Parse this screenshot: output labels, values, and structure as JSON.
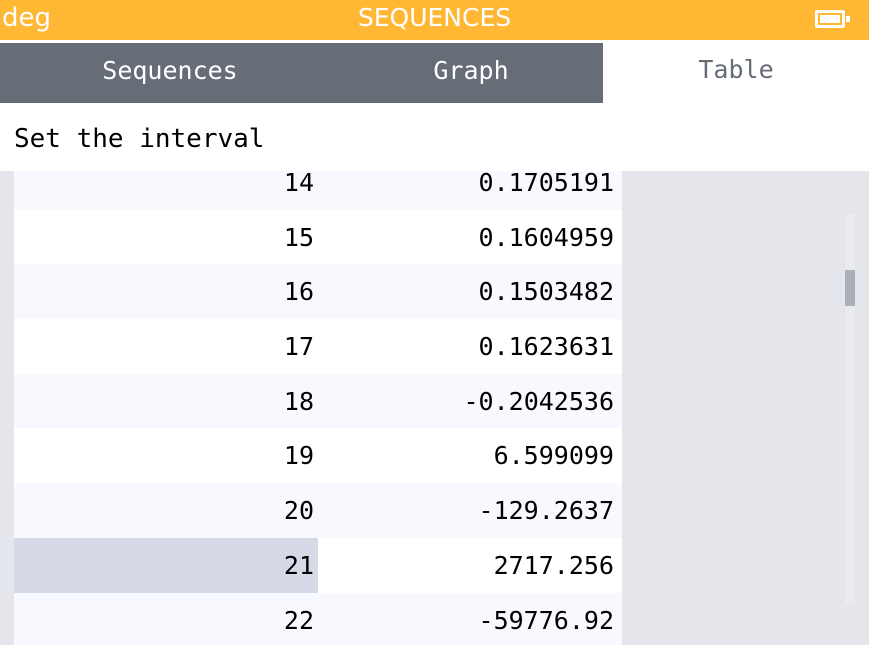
{
  "status_bar": {
    "mode": "deg",
    "title": "SEQUENCES",
    "battery_icon": "battery-icon",
    "color": "#ffb734"
  },
  "tabs": [
    {
      "label": "Sequences",
      "active": false
    },
    {
      "label": "Graph",
      "active": false
    },
    {
      "label": "Table",
      "active": true
    }
  ],
  "interval": {
    "label": "Set the interval"
  },
  "table": {
    "rows": [
      {
        "n": "14",
        "u": "0.1705191"
      },
      {
        "n": "15",
        "u": "0.1604959"
      },
      {
        "n": "16",
        "u": "0.1503482"
      },
      {
        "n": "17",
        "u": "0.1623631"
      },
      {
        "n": "18",
        "u": "-0.2042536"
      },
      {
        "n": "19",
        "u": "6.599099"
      },
      {
        "n": "20",
        "u": "-129.2637"
      },
      {
        "n": "21",
        "u": "2717.256"
      },
      {
        "n": "22",
        "u": "-59776.92"
      }
    ],
    "selected_row": 7
  },
  "colors": {
    "tab_bar": "#666d76",
    "table_background": "#e4e6eb",
    "selected_cell": "#d6d9e6"
  }
}
